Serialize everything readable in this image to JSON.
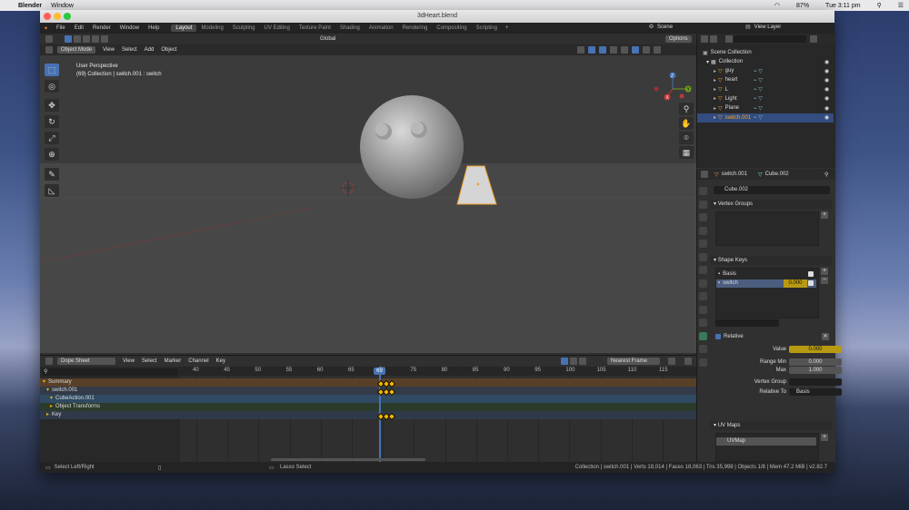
{
  "mac_menubar": {
    "app": "Blender",
    "window": "Window",
    "battery": "87%",
    "clock": "Tue 3:11 pm"
  },
  "window": {
    "title": "3dHeart.blend"
  },
  "topbar": {
    "menus": [
      "File",
      "Edit",
      "Render",
      "Window",
      "Help"
    ],
    "workspaces": [
      "Layout",
      "Modeling",
      "Sculpting",
      "UV Editing",
      "Texture Paint",
      "Shading",
      "Animation",
      "Rendering",
      "Compositing",
      "Scripting"
    ],
    "active_workspace": "Layout",
    "add_tab": "+",
    "scene": "Scene",
    "view_layer": "View Layer"
  },
  "tool_header": {
    "transform": "Global",
    "options": "Options"
  },
  "viewport_header": {
    "mode": "Object Mode",
    "menus": [
      "View",
      "Select",
      "Add",
      "Object"
    ]
  },
  "viewport": {
    "overlay_line1": "User Perspective",
    "overlay_line2": "(69) Collection | switch.001 : switch"
  },
  "navgizmo": {
    "z": "Z",
    "y": "Y",
    "x": "X"
  },
  "outliner": {
    "root": "Scene Collection",
    "collection": "Collection",
    "items": [
      "guy",
      "heart",
      "L",
      "Light",
      "Plane",
      "switch.001"
    ],
    "selected": "switch.001"
  },
  "properties": {
    "object": "switch.001",
    "mesh": "Cube.002",
    "mesh_field": "Cube.002",
    "vertex_groups": "Vertex Groups",
    "shape_keys": "Shape Keys",
    "keys": [
      {
        "name": "Basis",
        "value": ""
      },
      {
        "name": "switch",
        "value": "0.000"
      }
    ],
    "relative": "Relative",
    "value_label": "Value",
    "value": "0.000",
    "range_min_label": "Range Min",
    "range_min": "0.000",
    "max_label": "Max",
    "max": "1.000",
    "vertex_group_label": "Vertex Group",
    "relative_to_label": "Relative To",
    "relative_to": "Basis",
    "uv_maps": "UV Maps",
    "uv_map_name": "UVMap"
  },
  "dopesheet": {
    "editor": "Dope Sheet",
    "menus": [
      "View",
      "Select",
      "Marker",
      "Channel",
      "Key"
    ],
    "snap": "Nearest Frame",
    "current_frame": "69",
    "ticks": [
      "40",
      "45",
      "50",
      "55",
      "60",
      "65",
      "70",
      "75",
      "80",
      "85",
      "90",
      "95",
      "100",
      "105",
      "110",
      "115"
    ],
    "channels": [
      "Summary",
      "switch.001",
      "CubeAction.001",
      "Object Transforms",
      "Key"
    ]
  },
  "statusbar": {
    "left": "Select Left/Right",
    "mid": "Lasso Select",
    "right": "Collection | switch.001 | Verts 18,014 | Faces 18,063 | Tris 35,998 | Objects 1/8 | Mem 47.2 MiB | v2.82.7"
  },
  "colors": {
    "accent": "#4772b3",
    "keyframe": "#f0b400",
    "selected_row": "#334d80"
  }
}
